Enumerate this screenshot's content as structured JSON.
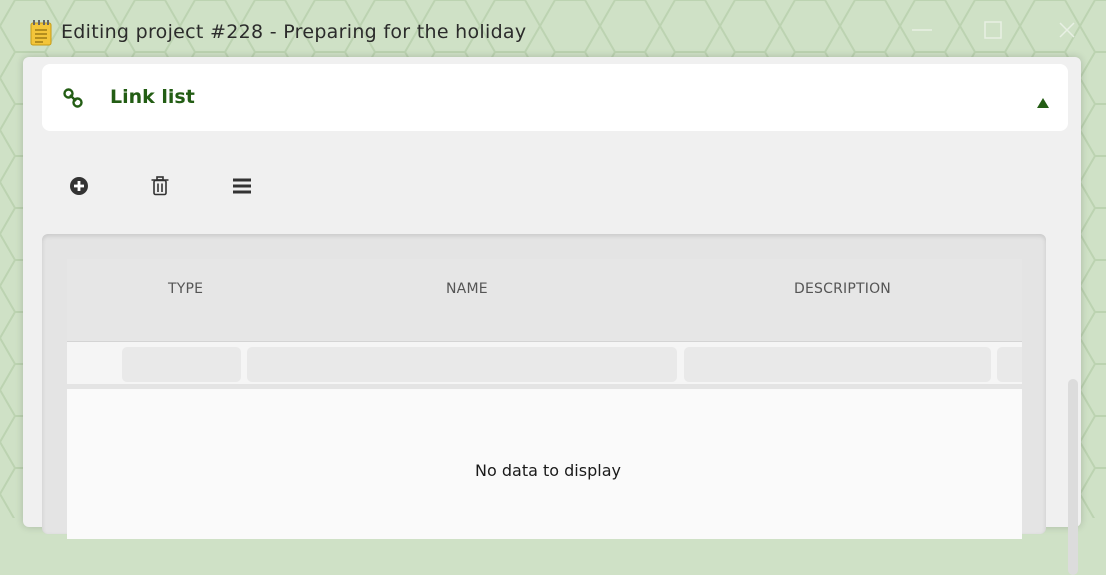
{
  "window": {
    "title": "Editing project #228 - Preparing for the holiday",
    "icons": {
      "app": "notepad-icon",
      "minimize": "minimize-icon",
      "maximize": "maximize-icon",
      "close": "close-icon"
    }
  },
  "panel": {
    "title": "Link list",
    "icons": {
      "header": "link-icon",
      "toggle": "collapse-arrow-icon"
    },
    "accent_color": "#235d14"
  },
  "toolbar": {
    "items": [
      {
        "icon": "add-circle-icon"
      },
      {
        "icon": "trash-icon"
      },
      {
        "icon": "menu-icon"
      }
    ]
  },
  "grid": {
    "columns": [
      "TYPE",
      "NAME",
      "DESCRIPTION"
    ],
    "empty_text": "No data to display"
  }
}
